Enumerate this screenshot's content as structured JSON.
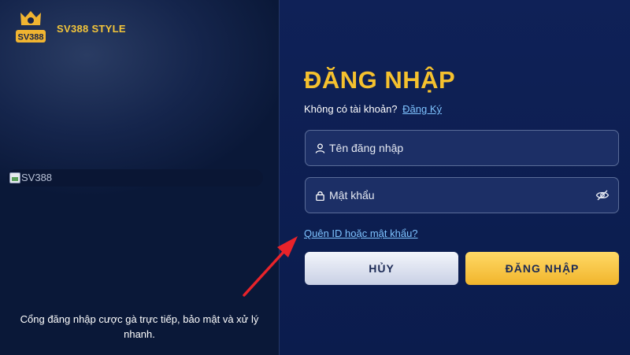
{
  "brand": {
    "logo_text": "SV388",
    "name": "SV388 STYLE",
    "accent_color": "#f5c12e"
  },
  "left_panel": {
    "broken_image_alt": "SV388",
    "tagline": "Cổng đăng nhập cược gà trực tiếp, bảo mật và xử lý nhanh."
  },
  "login": {
    "title": "ĐĂNG NHẬP",
    "signup_prompt": "Không có tài khoản?",
    "signup_link": "Đăng Ký",
    "username_placeholder": "Tên đăng nhập",
    "password_placeholder": "Mật khẩu",
    "forgot_link": "Quên ID hoặc mật khẩu?",
    "cancel_label": "HỦY",
    "submit_label": "ĐĂNG NHẬP"
  },
  "icons": {
    "username": "user-icon",
    "password": "lock-icon",
    "toggle_password": "eye-slash-icon",
    "annotation": "red-arrow"
  },
  "colors": {
    "link": "#7ec3ff",
    "arrow": "#e8232a",
    "cancel_button": "#dfe4f1",
    "submit_button": "#f7c642"
  }
}
